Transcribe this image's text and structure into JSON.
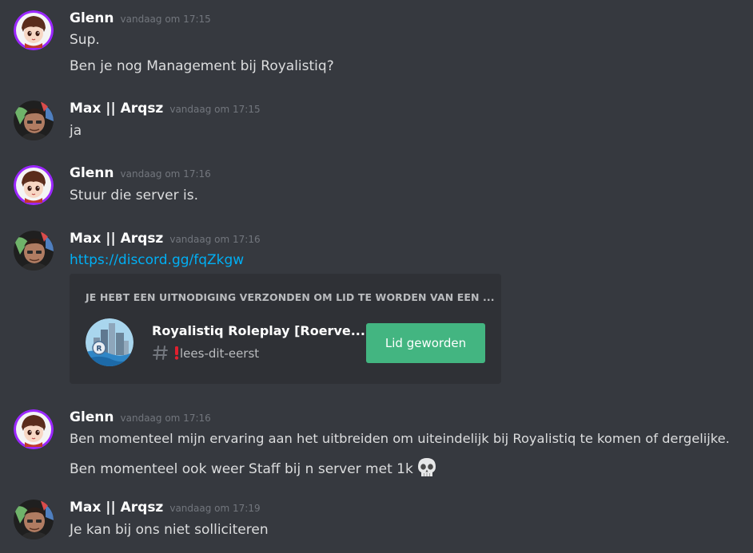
{
  "colors": {
    "background": "#36393f",
    "embed_background": "#2f3136",
    "link": "#00aff4",
    "join_button": "#43b581",
    "avatar_ring": "#9b27ff"
  },
  "messages": [
    {
      "author": "Glenn",
      "timestamp": "vandaag om 17:15",
      "avatar_icon": "anime-boy-avatar-icon",
      "lines": [
        "Sup.",
        "Ben je nog Management bij Royalistiq?"
      ]
    },
    {
      "author": "Max || Arqsz",
      "timestamp": "vandaag om 17:15",
      "avatar_icon": "man-photo-avatar-icon",
      "lines": [
        "ja"
      ]
    },
    {
      "author": "Glenn",
      "timestamp": "vandaag om 17:16",
      "avatar_icon": "anime-boy-avatar-icon",
      "lines": [
        "Stuur die server is."
      ]
    },
    {
      "author": "Max || Arqsz",
      "timestamp": "vandaag om 17:16",
      "avatar_icon": "man-photo-avatar-icon",
      "link": "https://discord.gg/fqZkgw",
      "invite": {
        "heading": "JE HEBT EEN UITNODIGING VERZONDEN OM LID TE WORDEN VAN EEN ...",
        "server_name": "Royalistiq Roleplay [Roerve...",
        "channel_name": "lees-dit-eerst",
        "channel_prefix_icon": "red-exclamation-icon",
        "join_label": "Lid geworden"
      }
    },
    {
      "author": "Glenn",
      "timestamp": "vandaag om 17:16",
      "avatar_icon": "anime-boy-avatar-icon",
      "lines": [
        "Ben momenteel mijn ervaring aan het uitbreiden om uiteindelijk bij Royalistiq te komen of dergelijke.",
        "Ben momenteel ook weer Staff bij n server met 1k"
      ],
      "trailing_emoji": "skull-emoji-icon"
    },
    {
      "author": "Max || Arqsz",
      "timestamp": "vandaag om 17:19",
      "avatar_icon": "man-photo-avatar-icon",
      "lines": [
        "Je kan bij ons niet solliciteren"
      ]
    }
  ]
}
